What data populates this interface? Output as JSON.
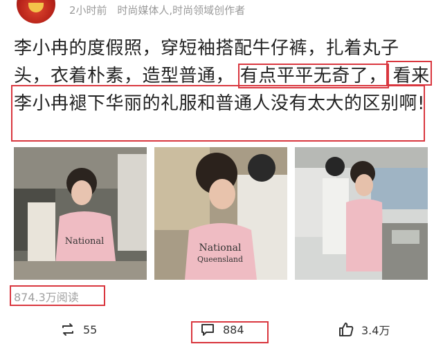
{
  "post": {
    "time": "2小时前",
    "author_tag": "时尚媒体人,时尚领域创作者",
    "text_part1": "李小冉的度假照，穿短袖搭配牛仔裤，扎着丸子头，衣着朴素，造型普通，",
    "text_highlight1": "有点平平无奇了，",
    "text_highlight2": "看来李小冉褪下华丽的礼服和普通人没有太大的区别啊!",
    "photos": [
      {
        "icon": "photo-1"
      },
      {
        "icon": "photo-2"
      },
      {
        "icon": "photo-3"
      }
    ],
    "views": "874.3万阅读"
  },
  "actions": {
    "repost_count": "55",
    "comment_count": "884",
    "like_count": "3.4万"
  },
  "colors": {
    "highlight": "#d9363e",
    "meta": "#9a9a9a"
  }
}
